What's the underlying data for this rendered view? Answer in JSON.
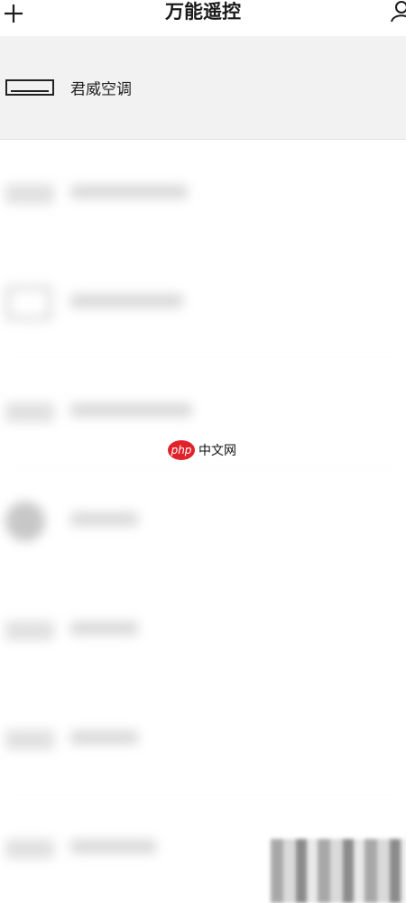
{
  "header": {
    "title": "万能遥控",
    "add_icon": "plus-icon",
    "user_icon": "user-icon"
  },
  "devices": [
    {
      "label": "君威空调",
      "icon": "air-conditioner-icon"
    }
  ],
  "watermark": {
    "logo_text": "php",
    "text": "中文网"
  },
  "colors": {
    "selected_row": "#f2f2f2",
    "watermark_red": "#e0232a"
  }
}
